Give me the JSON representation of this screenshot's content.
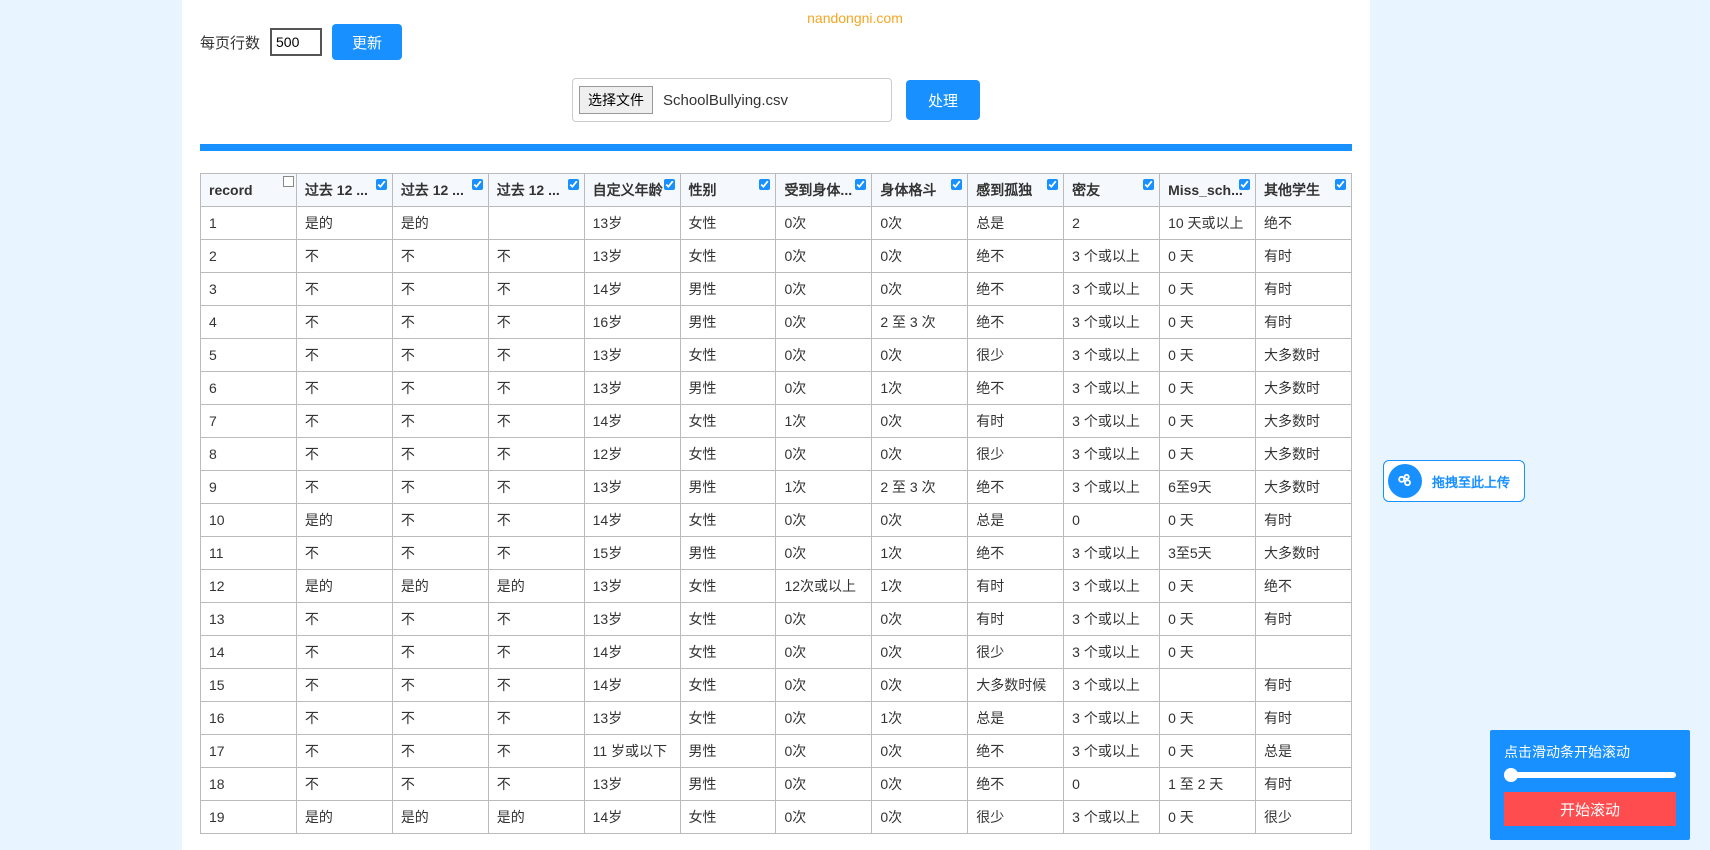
{
  "watermark": "nandongni.com",
  "controls": {
    "rows_per_page_label": "每页行数",
    "rows_per_page_value": "500",
    "update_label": "更新",
    "choose_file_label": "选择文件",
    "file_name": "SchoolBullying.csv",
    "process_label": "处理"
  },
  "table": {
    "columns": [
      {
        "key": "record",
        "label": "record",
        "checked": false
      },
      {
        "key": "c1",
        "label": "过去 12 ...",
        "checked": true
      },
      {
        "key": "c2",
        "label": "过去 12 ...",
        "checked": true
      },
      {
        "key": "c3",
        "label": "过去 12 ...",
        "checked": true
      },
      {
        "key": "c4",
        "label": "自定义年龄",
        "checked": true
      },
      {
        "key": "c5",
        "label": "性别",
        "checked": true
      },
      {
        "key": "c6",
        "label": "受到身体...",
        "checked": true
      },
      {
        "key": "c7",
        "label": "身体格斗",
        "checked": true
      },
      {
        "key": "c8",
        "label": "感到孤独",
        "checked": true
      },
      {
        "key": "c9",
        "label": "密友",
        "checked": true
      },
      {
        "key": "c10",
        "label": "Miss_sch...",
        "checked": true
      },
      {
        "key": "c11",
        "label": "其他学生",
        "checked": true
      }
    ],
    "rows": [
      [
        "1",
        "是的",
        "是的",
        "",
        "13岁",
        "女性",
        "0次",
        "0次",
        "总是",
        "2",
        "10 天或以上",
        "绝不"
      ],
      [
        "2",
        "不",
        "不",
        "不",
        "13岁",
        "女性",
        "0次",
        "0次",
        "绝不",
        "3 个或以上",
        "0 天",
        "有时"
      ],
      [
        "3",
        "不",
        "不",
        "不",
        "14岁",
        "男性",
        "0次",
        "0次",
        "绝不",
        "3 个或以上",
        "0 天",
        "有时"
      ],
      [
        "4",
        "不",
        "不",
        "不",
        "16岁",
        "男性",
        "0次",
        "2 至 3 次",
        "绝不",
        "3 个或以上",
        "0 天",
        "有时"
      ],
      [
        "5",
        "不",
        "不",
        "不",
        "13岁",
        "女性",
        "0次",
        "0次",
        "很少",
        "3 个或以上",
        "0 天",
        "大多数时"
      ],
      [
        "6",
        "不",
        "不",
        "不",
        "13岁",
        "男性",
        "0次",
        "1次",
        "绝不",
        "3 个或以上",
        "0 天",
        "大多数时"
      ],
      [
        "7",
        "不",
        "不",
        "不",
        "14岁",
        "女性",
        "1次",
        "0次",
        "有时",
        "3 个或以上",
        "0 天",
        "大多数时"
      ],
      [
        "8",
        "不",
        "不",
        "不",
        "12岁",
        "女性",
        "0次",
        "0次",
        "很少",
        "3 个或以上",
        "0 天",
        "大多数时"
      ],
      [
        "9",
        "不",
        "不",
        "不",
        "13岁",
        "男性",
        "1次",
        "2 至 3 次",
        "绝不",
        "3 个或以上",
        "6至9天",
        "大多数时"
      ],
      [
        "10",
        "是的",
        "不",
        "不",
        "14岁",
        "女性",
        "0次",
        "0次",
        "总是",
        "0",
        "0 天",
        "有时"
      ],
      [
        "11",
        "不",
        "不",
        "不",
        "15岁",
        "男性",
        "0次",
        "1次",
        "绝不",
        "3 个或以上",
        "3至5天",
        "大多数时"
      ],
      [
        "12",
        "是的",
        "是的",
        "是的",
        "13岁",
        "女性",
        "12次或以上",
        "1次",
        "有时",
        "3 个或以上",
        "0 天",
        "绝不"
      ],
      [
        "13",
        "不",
        "不",
        "不",
        "13岁",
        "女性",
        "0次",
        "0次",
        "有时",
        "3 个或以上",
        "0 天",
        "有时"
      ],
      [
        "14",
        "不",
        "不",
        "不",
        "14岁",
        "女性",
        "0次",
        "0次",
        "很少",
        "3 个或以上",
        "0 天",
        ""
      ],
      [
        "15",
        "不",
        "不",
        "不",
        "14岁",
        "女性",
        "0次",
        "0次",
        "大多数时候",
        "3 个或以上",
        "",
        "有时"
      ],
      [
        "16",
        "不",
        "不",
        "不",
        "13岁",
        "女性",
        "0次",
        "1次",
        "总是",
        "3 个或以上",
        "0 天",
        "有时"
      ],
      [
        "17",
        "不",
        "不",
        "不",
        "11 岁或以下",
        "男性",
        "0次",
        "0次",
        "绝不",
        "3 个或以上",
        "0 天",
        "总是"
      ],
      [
        "18",
        "不",
        "不",
        "不",
        "13岁",
        "男性",
        "0次",
        "0次",
        "绝不",
        "0",
        "1 至 2 天",
        "有时"
      ],
      [
        "19",
        "是的",
        "是的",
        "是的",
        "14岁",
        "女性",
        "0次",
        "0次",
        "很少",
        "3 个或以上",
        "0 天",
        "很少"
      ]
    ]
  },
  "upload_widget": {
    "text": "拖拽至此上传"
  },
  "scroll_panel": {
    "title": "点击滑动条开始滚动",
    "button": "开始滚动"
  }
}
